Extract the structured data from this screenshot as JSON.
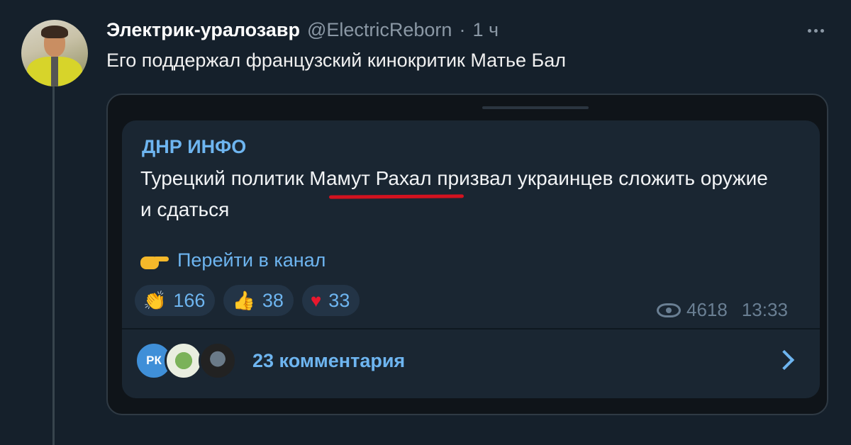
{
  "tweet": {
    "author_name": "Электрик-уралозавр",
    "author_handle": "@ElectricReborn",
    "separator": "·",
    "time": "1 ч",
    "text": "Его поддержал французский кинокритик Матье Бал"
  },
  "telegram_post": {
    "channel": "ДНР ИНФО",
    "text": "Турецкий политик Мамут Рахал призвал украинцев сложить оружие и сдаться",
    "goto_label": "Перейти в канал",
    "reactions": [
      {
        "icon": "clapping-hands-icon",
        "glyph": "👏",
        "count": "166"
      },
      {
        "icon": "thumbs-up-icon",
        "glyph": "👍",
        "count": "38"
      },
      {
        "icon": "heart-icon",
        "glyph": "♥",
        "count": "33"
      }
    ],
    "views": "4618",
    "post_time": "13:33",
    "comment_avatars": [
      {
        "initials": "РК",
        "color": "#3f8fd8"
      },
      {
        "initials": "",
        "color": "#7bb25a"
      },
      {
        "initials": "",
        "color": "#6a7a88"
      }
    ],
    "comments_label": "23 комментария"
  },
  "colors": {
    "background": "#15202b",
    "link_blue": "#6eb5f0",
    "underline_red": "#d3121f"
  }
}
